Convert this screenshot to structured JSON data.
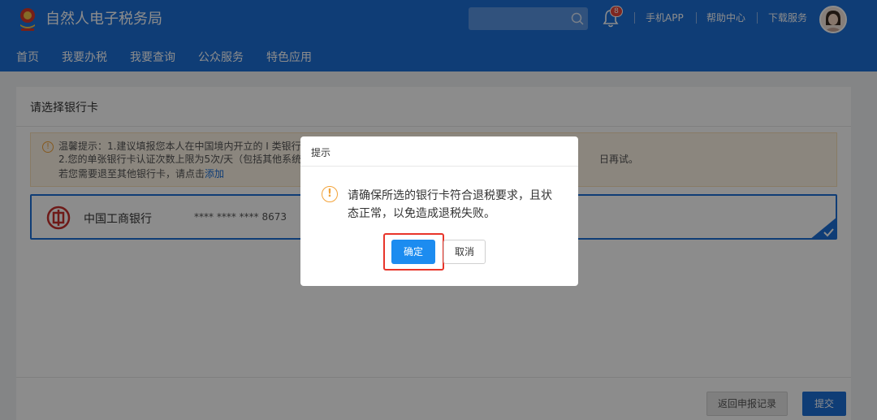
{
  "header": {
    "app_title": "自然人电子税务局",
    "notification_count": "8",
    "links": [
      "手机APP",
      "帮助中心",
      "下载服务"
    ],
    "nav": [
      "首页",
      "我要办税",
      "我要查询",
      "公众服务",
      "特色应用"
    ]
  },
  "page": {
    "section_title": "请选择银行卡",
    "tips": {
      "line1": "温馨提示：1.建议填报您本人在中国境内开立的 I 类银行",
      "line1_end": "日再试。",
      "line2": "2.您的单张银行卡认证次数上限为5次/天（包括其他系统",
      "line3_prefix": "若您需要退至其他银行卡，请点击",
      "line3_link": "添加"
    },
    "bank_card": {
      "name": "中国工商银行",
      "number": "**** **** **** 8673"
    },
    "footer": {
      "back_label": "返回申报记录",
      "submit_label": "提交"
    }
  },
  "dialog": {
    "title": "提示",
    "message": "请确保所选的银行卡符合退税要求，且状态正常，以免造成退税失败。",
    "ok_label": "确定",
    "cancel_label": "取消"
  },
  "colors": {
    "header_bg": "#1c6fd8",
    "primary_button": "#1c8cf0",
    "warning": "#f3a33a",
    "highlight": "#e8352a"
  }
}
